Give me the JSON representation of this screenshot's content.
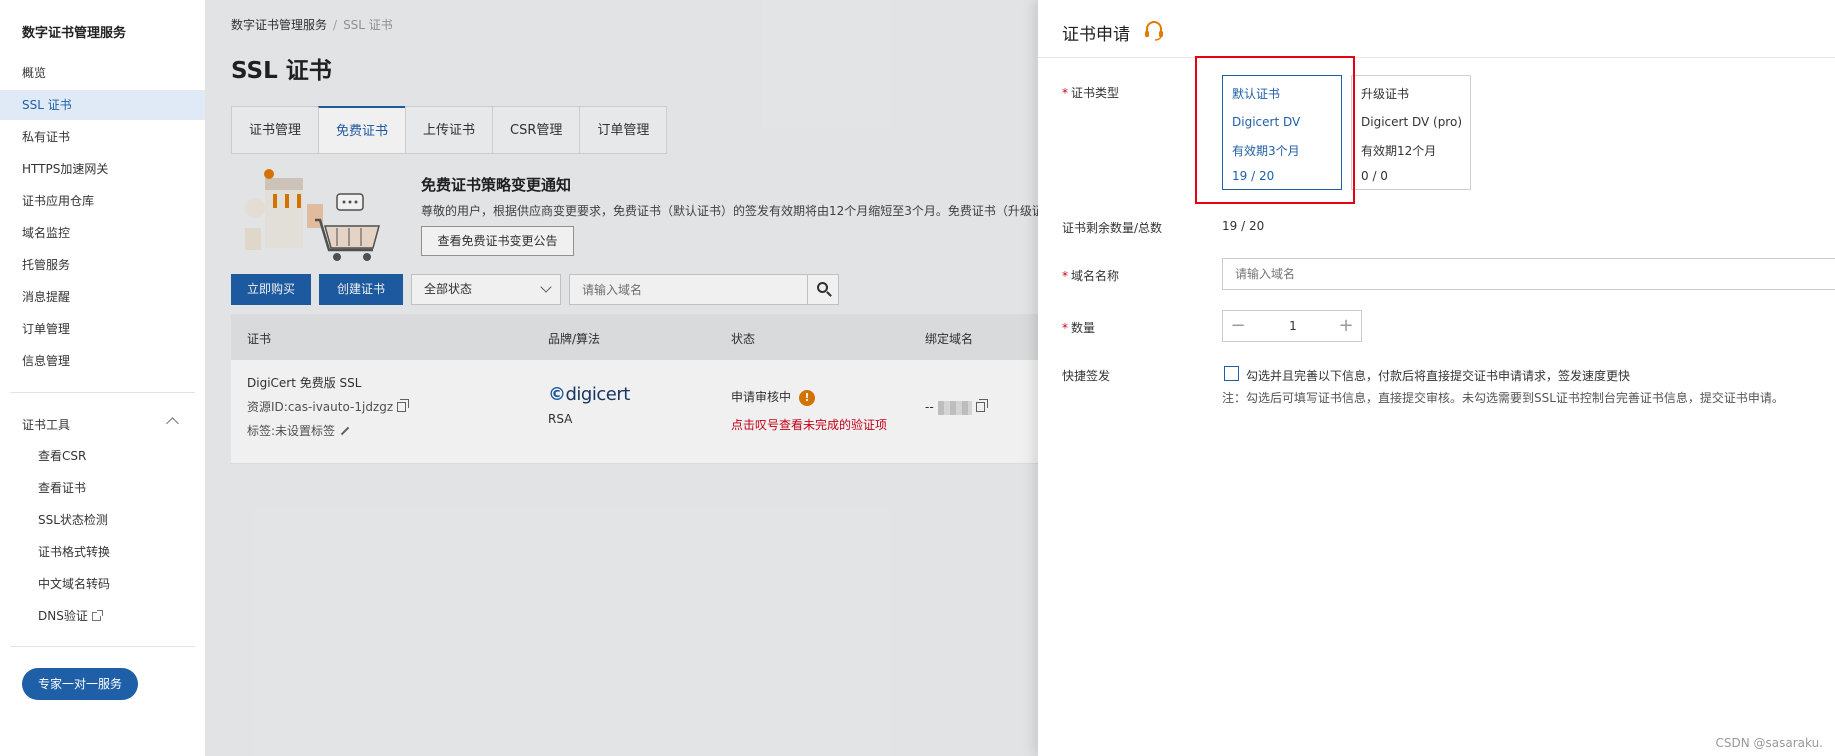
{
  "sidebar": {
    "title": "数字证书管理服务",
    "items": [
      {
        "label": "概览"
      },
      {
        "label": "SSL 证书",
        "active": true
      },
      {
        "label": "私有证书"
      },
      {
        "label": "HTTPS加速网关"
      },
      {
        "label": "证书应用仓库"
      },
      {
        "label": "域名监控"
      },
      {
        "label": "托管服务"
      },
      {
        "label": "消息提醒"
      },
      {
        "label": "订单管理"
      },
      {
        "label": "信息管理"
      }
    ],
    "tools_title": "证书工具",
    "tools": [
      {
        "label": "查看CSR"
      },
      {
        "label": "查看证书"
      },
      {
        "label": "SSL状态检测"
      },
      {
        "label": "证书格式转换"
      },
      {
        "label": "中文域名转码"
      },
      {
        "label": "DNS验证"
      }
    ],
    "expert_button": "专家一对一服务"
  },
  "main": {
    "breadcrumb": [
      "数字证书管理服务",
      "SSL 证书"
    ],
    "page_title": "SSL 证书",
    "tabs": [
      {
        "label": "证书管理"
      },
      {
        "label": "免费证书",
        "active": true
      },
      {
        "label": "上传证书"
      },
      {
        "label": "CSR管理"
      },
      {
        "label": "订单管理"
      }
    ],
    "notice": {
      "title": "免费证书策略变更通知",
      "text": "尊敬的用户，根据供应商变更要求，免费证书（默认证书）的签发有效期将由12个月缩短至3个月。免费证书（升级证",
      "button": "查看免费证书变更公告"
    },
    "toolbar": {
      "buy_button": "立即购买",
      "create_button": "创建证书",
      "status_select": "全部状态",
      "search_placeholder": "请输入域名"
    },
    "table": {
      "headers": [
        "证书",
        "品牌/算法",
        "状态",
        "绑定域名"
      ],
      "rows": [
        {
          "cert_name": "DigiCert 免费版 SSL",
          "resource_id": "资源ID:cas-ivauto-1jdzgz",
          "tag": "标签:未设置标签",
          "brand": "digicert",
          "algorithm": "RSA",
          "status": "申请审核中",
          "status_link": "点击叹号查看未完成的验证项",
          "domain": "--"
        }
      ]
    }
  },
  "drawer": {
    "title": "证书申请",
    "cert_type_label": "证书类型",
    "cards": [
      {
        "type": "默认证书",
        "brand": "Digicert DV",
        "validity": "有效期3个月",
        "quota": "19 / 20",
        "selected": true
      },
      {
        "type": "升级证书",
        "brand": "Digicert DV (pro)",
        "validity": "有效期12个月",
        "quota": "0 / 0",
        "selected": false
      }
    ],
    "remaining_label": "证书剩余数量/总数",
    "remaining_value": "19 / 20",
    "domain_label": "域名名称",
    "domain_placeholder": "请输入域名",
    "quantity_label": "数量",
    "quantity_value": "1",
    "quick_label": "快捷签发",
    "quick_checkbox_text": "勾选并且完善以下信息，付款后将直接提交证书申请请求，签发速度更快",
    "quick_note": "注：勾选后可填写证书信息，直接提交审核。未勾选需要到SSL证书控制台完善证书信息，提交证书申请。"
  },
  "watermark": "CSDN @sasaraku.",
  "colors": {
    "primary": "#1f5fa8",
    "highlight_box": "#e60012",
    "warning": "#e27a00",
    "danger_text": "#d0021b"
  }
}
